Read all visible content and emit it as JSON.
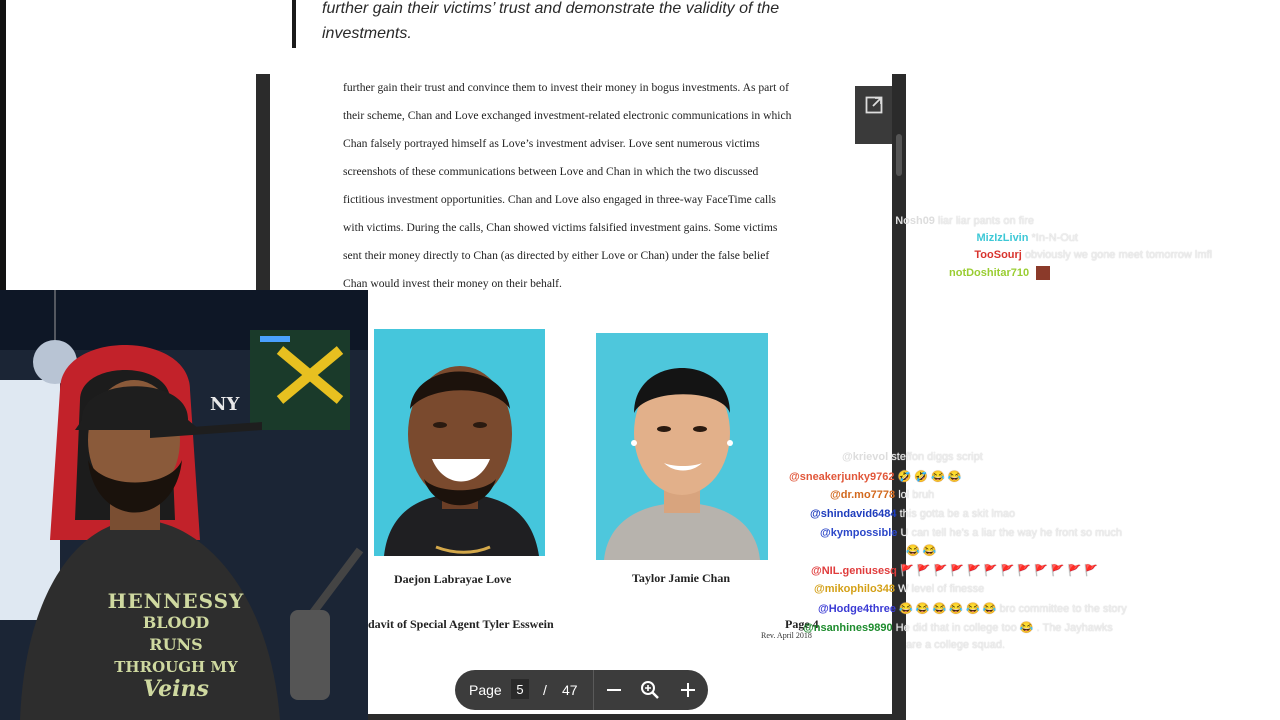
{
  "article": {
    "quote_line1": "further gain their victims’ trust and demonstrate the validity of the",
    "quote_line2": "investments."
  },
  "pdf": {
    "paragraph_lines": [
      "further gain their trust and convince them to invest their money in bogus investments.  As part of",
      "their scheme, Chan and Love exchanged investment-related electronic communications in which",
      "Chan falsely portrayed himself as Love’s investment adviser. Love sent numerous victims",
      "screenshots of these communications between Love and Chan in which the two discussed",
      "fictitious investment opportunities.  Chan and Love also engaged in three-way FaceTime calls",
      "with victims.  During the calls, Chan showed victims falsified investment gains.  Some victims",
      "sent their money directly to Chan (as directed by either Love or Chan) under the false belief",
      "Chan would invest their money on their behalf."
    ],
    "caption_left": "Daejon Labrayae Love",
    "caption_right": "Taylor Jamie Chan",
    "footer_left": "davit of Special Agent Tyler Esswein",
    "footer_page": "Page 4",
    "footer_rev": "Rev. April 2018",
    "popout_icon": "open-in-new-icon"
  },
  "page_nav": {
    "label": "Page",
    "current": "5",
    "separator": "/",
    "total": "47",
    "zoom_out_icon": "minus-icon",
    "fit_icon": "zoom-icon",
    "zoom_in_icon": "plus-icon"
  },
  "webcam": {
    "shirt_line1": "HENNESSY",
    "shirt_line2": "BLOOD",
    "shirt_line3": "RUNS",
    "shirt_line4": "THROUGH MY",
    "shirt_line5": "Veins",
    "cap_logo": "NY"
  },
  "chat_top": [
    {
      "user": "Nosh09",
      "text": "liar liar pants on fire",
      "color": "#dddddd"
    },
    {
      "user": "MizIzLivin",
      "text": "*In-N-Out",
      "color": "#3ec8d6"
    },
    {
      "user": "TooSourj",
      "text": "obviously we gone meet tomorrow lmfl",
      "color": "#d8342e"
    },
    {
      "user": "notDoshitar710",
      "text": "",
      "color": "#9acd32"
    }
  ],
  "chat_bottom": [
    {
      "user": "@krievol",
      "text": "steffon diggs script",
      "color": "#dddddd"
    },
    {
      "user": "@sneakerjunky9762",
      "text": "🤣 🤣 😂 😂",
      "color": "#e1573a"
    },
    {
      "user": "@dr.mo7778",
      "text": "lol bruh",
      "color": "#d2691e"
    },
    {
      "user": "@shindavid6484",
      "text": "this gotta be a skit lmao",
      "color": "#1e3cbd"
    },
    {
      "user": "@kympossible",
      "text": "U can tell he's a liar the way he front so much",
      "color": "#2b47c9"
    },
    {
      "user": "",
      "text": "😂 😂",
      "color": "#ffffff"
    },
    {
      "user": "@NIL.geniusesq",
      "text": "🚩 🚩 🚩 🚩 🚩 🚩 🚩 🚩 🚩 🚩 🚩 🚩",
      "color": "#e03c3c"
    },
    {
      "user": "@mikophilo348",
      "text": "W level of finesse",
      "color": "#d4a017"
    },
    {
      "user": "@Hodge4three",
      "text": "😂 😂 😂 😂 😂 😂 bro committee to the story",
      "color": "#3a3ad4"
    },
    {
      "user": "@nsanhines9890",
      "text": "He did that in college too 😂 . The Jayhawks",
      "color": "#1e8c2e"
    },
    {
      "user": "",
      "text": "are a college squad.",
      "color": "#ffffff"
    }
  ]
}
